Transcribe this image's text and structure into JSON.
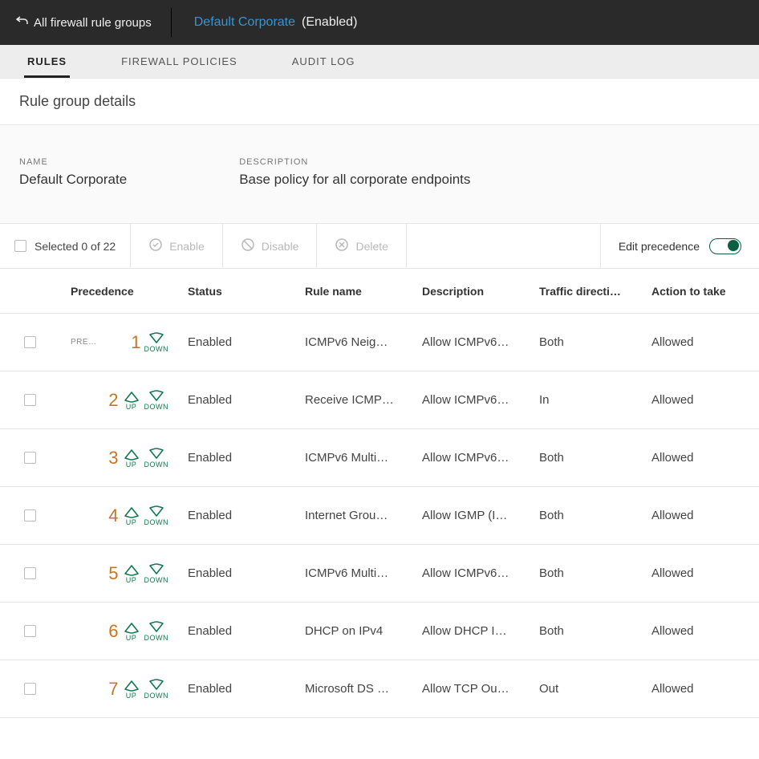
{
  "breadcrumb": {
    "back_label": "All firewall rule groups",
    "group_name": "Default Corporate",
    "group_state": "(Enabled)"
  },
  "tabs": {
    "rules": "RULES",
    "policies": "FIREWALL POLICIES",
    "audit": "AUDIT LOG"
  },
  "section_title": "Rule group details",
  "details": {
    "name_label": "NAME",
    "name_value": "Default Corporate",
    "desc_label": "DESCRIPTION",
    "desc_value": "Base policy for all corporate endpoints"
  },
  "toolbar": {
    "selected_label": "Selected 0 of 22",
    "enable": "Enable",
    "disable": "Disable",
    "delete": "Delete",
    "edit_precedence": "Edit precedence"
  },
  "columns": {
    "precedence": "Precedence",
    "status": "Status",
    "rule_name": "Rule name",
    "description": "Description",
    "traffic": "Traffic directi…",
    "action": "Action to take"
  },
  "prec": {
    "badge": "PRE…",
    "up": "UP",
    "down": "DOWN"
  },
  "rows": [
    {
      "n": "1",
      "status": "Enabled",
      "rule": "ICMPv6 Neig…",
      "desc": "Allow ICMPv6…",
      "dir": "Both",
      "action": "Allowed",
      "first": true
    },
    {
      "n": "2",
      "status": "Enabled",
      "rule": "Receive ICMP…",
      "desc": "Allow ICMPv6…",
      "dir": "In",
      "action": "Allowed",
      "first": false
    },
    {
      "n": "3",
      "status": "Enabled",
      "rule": "ICMPv6 Multi…",
      "desc": "Allow ICMPv6…",
      "dir": "Both",
      "action": "Allowed",
      "first": false
    },
    {
      "n": "4",
      "status": "Enabled",
      "rule": "Internet Grou…",
      "desc": "Allow IGMP (I…",
      "dir": "Both",
      "action": "Allowed",
      "first": false
    },
    {
      "n": "5",
      "status": "Enabled",
      "rule": "ICMPv6 Multi…",
      "desc": "Allow ICMPv6…",
      "dir": "Both",
      "action": "Allowed",
      "first": false
    },
    {
      "n": "6",
      "status": "Enabled",
      "rule": "DHCP on IPv4",
      "desc": "Allow DHCP I…",
      "dir": "Both",
      "action": "Allowed",
      "first": false
    },
    {
      "n": "7",
      "status": "Enabled",
      "rule": "Microsoft DS …",
      "desc": "Allow TCP Ou…",
      "dir": "Out",
      "action": "Allowed",
      "first": false
    }
  ]
}
